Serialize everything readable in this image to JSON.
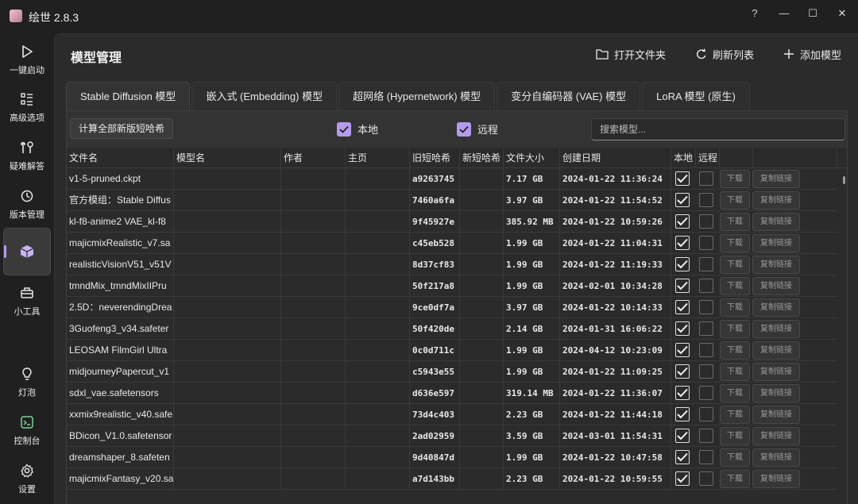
{
  "app": {
    "title": "绘世 2.8.3"
  },
  "window": {
    "help": "?",
    "minimize": "—",
    "maximize": "☐",
    "close": "✕"
  },
  "sidebar": {
    "items": [
      {
        "label": "一键启动",
        "icon": "play-icon"
      },
      {
        "label": "高级选项",
        "icon": "list-icon"
      },
      {
        "label": "疑难解答",
        "icon": "tools-icon"
      },
      {
        "label": "版本管理",
        "icon": "history-icon"
      },
      {
        "label": "",
        "icon": "cube-icon",
        "active": true
      },
      {
        "label": "小工具",
        "icon": "toolbox-icon"
      },
      {
        "label": "灯泡",
        "icon": "lightbulb-icon"
      },
      {
        "label": "控制台",
        "icon": "console-icon"
      },
      {
        "label": "设置",
        "icon": "gear-icon"
      }
    ]
  },
  "header": {
    "title": "模型管理",
    "open_folder": "打开文件夹",
    "refresh": "刷新列表",
    "add_model": "添加模型"
  },
  "tabs": [
    {
      "label": "Stable Diffusion 模型",
      "active": true
    },
    {
      "label": "嵌入式 (Embedding) 模型"
    },
    {
      "label": "超网络 (Hypernetwork) 模型"
    },
    {
      "label": "变分自编码器 (VAE) 模型"
    },
    {
      "label": "LoRA 模型 (原生)"
    }
  ],
  "toolbar": {
    "calc_hash": "计算全部新版短哈希",
    "local_label": "本地",
    "remote_label": "远程",
    "search_placeholder": "搜索模型..."
  },
  "table": {
    "headers": [
      "文件名",
      "模型名",
      "作者",
      "主页",
      "旧短哈希",
      "新短哈希",
      "文件大小",
      "创建日期",
      "本地",
      "远程"
    ],
    "download_label": "下载",
    "copy_label": "复制链接",
    "rows": [
      {
        "file": "v1-5-pruned.ckpt",
        "old_hash": "a9263745",
        "size": "7.17 GB",
        "date": "2024-01-22 11:36:24"
      },
      {
        "file": "官方模组：Stable Diffus",
        "old_hash": "7460a6fa",
        "size": "3.97 GB",
        "date": "2024-01-22 11:54:52"
      },
      {
        "file": "kl-f8-anime2 VAE_kl-f8",
        "old_hash": "9f45927e",
        "size": "385.92 MB",
        "date": "2024-01-22 10:59:26"
      },
      {
        "file": "majicmixRealistic_v7.sa",
        "old_hash": "c45eb528",
        "size": "1.99 GB",
        "date": "2024-01-22 11:04:31"
      },
      {
        "file": "realisticVisionV51_v51V",
        "old_hash": "8d37cf83",
        "size": "1.99 GB",
        "date": "2024-01-22 11:19:33"
      },
      {
        "file": "tmndMix_tmndMixIIPru",
        "old_hash": "50f217a8",
        "size": "1.99 GB",
        "date": "2024-02-01 10:34:28"
      },
      {
        "file": "2.5D：neverendingDrea",
        "old_hash": "9ce0df7a",
        "size": "3.97 GB",
        "date": "2024-01-22 10:14:33"
      },
      {
        "file": "3Guofeng3_v34.safeter",
        "old_hash": "50f420de",
        "size": "2.14 GB",
        "date": "2024-01-31 16:06:22"
      },
      {
        "file": "LEOSAM FilmGirl Ultra",
        "old_hash": "0c0d711c",
        "size": "1.99 GB",
        "date": "2024-04-12 10:23:09"
      },
      {
        "file": "midjourneyPapercut_v1",
        "old_hash": "c5943e55",
        "size": "1.99 GB",
        "date": "2024-01-22 11:09:25"
      },
      {
        "file": "sdxl_vae.safetensors",
        "old_hash": "d636e597",
        "size": "319.14 MB",
        "date": "2024-01-22 11:36:07"
      },
      {
        "file": "xxmix9realistic_v40.safe",
        "old_hash": "73d4c403",
        "size": "2.23 GB",
        "date": "2024-01-22 11:44:18"
      },
      {
        "file": "BDicon_V1.0.safetensor",
        "old_hash": "2ad02959",
        "size": "3.59 GB",
        "date": "2024-03-01 11:54:31"
      },
      {
        "file": "dreamshaper_8.safeten",
        "old_hash": "9d40847d",
        "size": "1.99 GB",
        "date": "2024-01-22 10:47:58"
      },
      {
        "file": "majicmixFantasy_v20.sa",
        "old_hash": "a7d143bb",
        "size": "2.23 GB",
        "date": "2024-01-22 10:59:55"
      }
    ]
  },
  "colors": {
    "accent": "#b49aeb",
    "background": "#202020",
    "panel": "#2b2b2b"
  }
}
